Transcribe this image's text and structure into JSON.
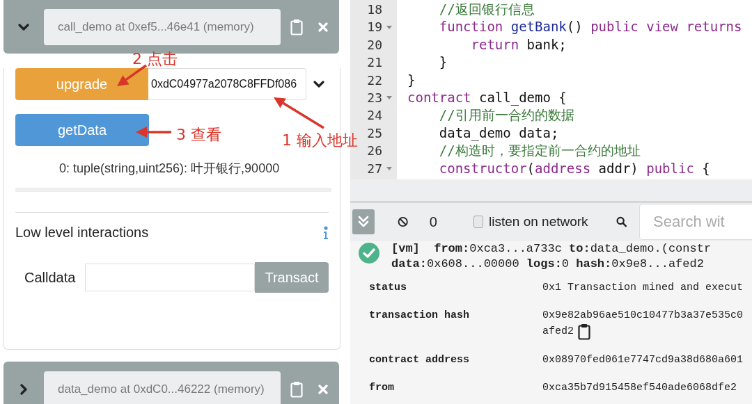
{
  "contracts": [
    {
      "title": "call_demo at 0xef5...46e41 (memory)",
      "expanded": true,
      "functions": [
        {
          "name": "upgrade",
          "kind": "transact",
          "input_value": "0xdC04977a2078C8FFDf086"
        },
        {
          "name": "getData",
          "kind": "call"
        }
      ],
      "output": "0: tuple(string,uint256): 叶开银行,90000",
      "low_level": {
        "title": "Low level interactions",
        "field_label": "Calldata",
        "button": "Transact"
      }
    },
    {
      "title": "data_demo at 0xdC0...46222 (memory)",
      "expanded": false
    }
  ],
  "annotations": [
    {
      "text": "2 点击"
    },
    {
      "text": "3 查看"
    },
    {
      "text": "1 输入地址"
    }
  ],
  "editor": {
    "lines": [
      {
        "number": "18",
        "fold": false,
        "tokens": [
          {
            "kind": "comment",
            "text": "    //返回银行信息"
          }
        ]
      },
      {
        "number": "19",
        "fold": true,
        "tokens": [
          {
            "kind": "keyword",
            "text": "    function "
          },
          {
            "kind": "name",
            "text": "getBank"
          },
          {
            "kind": "plain",
            "text": "() "
          },
          {
            "kind": "keyword",
            "text": "public view returns"
          }
        ]
      },
      {
        "number": "20",
        "fold": false,
        "tokens": [
          {
            "kind": "keyword",
            "text": "        return"
          },
          {
            "kind": "plain",
            "text": " bank;"
          }
        ]
      },
      {
        "number": "21",
        "fold": false,
        "tokens": [
          {
            "kind": "plain",
            "text": "    }"
          }
        ]
      },
      {
        "number": "22",
        "fold": false,
        "tokens": [
          {
            "kind": "plain",
            "text": "}"
          }
        ]
      },
      {
        "number": "23",
        "fold": true,
        "tokens": [
          {
            "kind": "keyword",
            "text": "contract"
          },
          {
            "kind": "plain",
            "text": " call_demo {"
          }
        ]
      },
      {
        "number": "24",
        "fold": false,
        "tokens": [
          {
            "kind": "comment",
            "text": "    //引用前一合约的数据"
          }
        ]
      },
      {
        "number": "25",
        "fold": false,
        "tokens": [
          {
            "kind": "plain",
            "text": "    data_demo data;"
          }
        ]
      },
      {
        "number": "26",
        "fold": false,
        "tokens": [
          {
            "kind": "comment",
            "text": "    //构造时，要指定前一合约的地址"
          }
        ]
      },
      {
        "number": "27",
        "fold": true,
        "tokens": [
          {
            "kind": "keyword",
            "text": "    constructor"
          },
          {
            "kind": "plain",
            "text": "("
          },
          {
            "kind": "keyword",
            "text": "address"
          },
          {
            "kind": "plain",
            "text": " addr) "
          },
          {
            "kind": "keyword",
            "text": "public"
          },
          {
            "kind": "plain",
            "text": " {"
          }
        ]
      }
    ]
  },
  "terminal": {
    "count": "0",
    "listen_label": "listen on network",
    "listen_checked": false,
    "search_placeholder": "Search wit",
    "log": {
      "summary": [
        "**[vm]**  **from:**0xca3...a733c **to:**data_demo.(constr",
        "**data:**0x608...00000 **logs:**0 **hash:**0x9e8...afed2"
      ],
      "rows": [
        {
          "key": "status",
          "lines": [
            "0x1 Transaction mined and execut"
          ],
          "copy": false
        },
        {
          "key": "transaction hash",
          "lines": [
            "0x9e82ab96ae510c10477b3a37e535c0",
            "afed2"
          ],
          "copy": true
        },
        {
          "key": "contract address",
          "lines": [
            "0x08970fed061e7747cd9a38d680a601"
          ],
          "copy": false
        },
        {
          "key": "from",
          "lines": [
            "0xca35b7d915458ef540ade6068dfe2"
          ],
          "copy": false
        }
      ]
    }
  }
}
